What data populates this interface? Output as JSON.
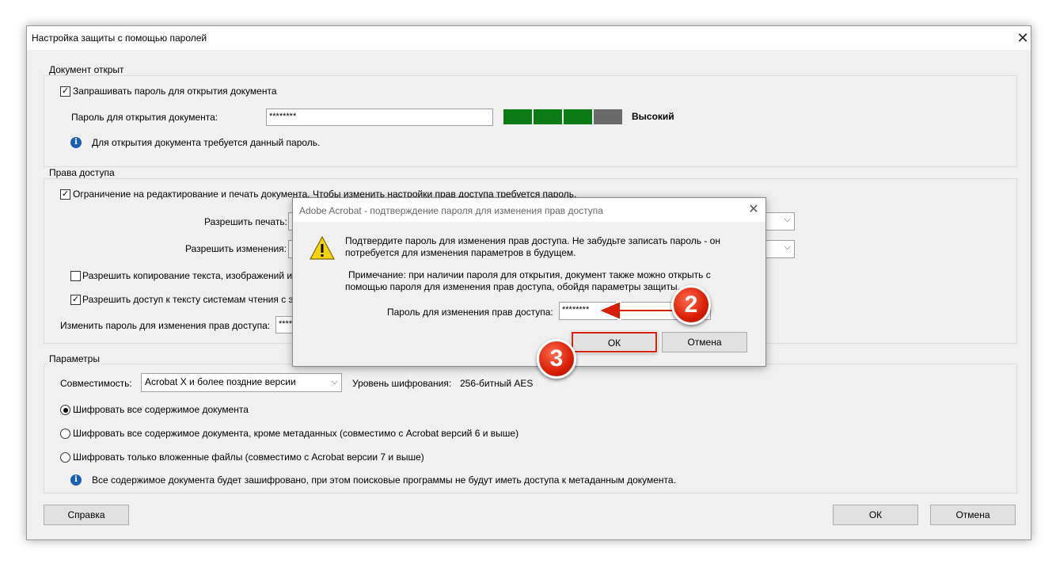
{
  "window": {
    "title": "Настройка защиты с помощью паролей"
  },
  "open_section": {
    "title": "Документ открыт",
    "require_label": "Запрашивать пароль для открытия документа",
    "require_checked": true,
    "password_label": "Пароль для открытия документа:",
    "password_value": "********",
    "strength_label": "Высокий",
    "strength_fraction": 0.75,
    "strength_colors": [
      "#0c7a14",
      "#0c7a14",
      "#0c7a14",
      "#6a6a6a"
    ],
    "info": "Для открытия документа требуется данный пароль."
  },
  "permissions_section": {
    "title": "Права доступа",
    "restrict_label": "Ограничение на редактирование и печать документа. Чтобы изменить настройки прав доступа требуется пароль.",
    "restrict_checked": true,
    "allow_print_label": "Разрешить печать:",
    "allow_changes_label": "Разрешить изменения:",
    "copy_label": "Разрешить копирование текста, изображений и",
    "copy_checked": false,
    "screenreader_label": "Разрешить доступ к тексту системам чтения с эк",
    "screenreader_checked": true,
    "change_pw_label": "Изменить пароль для изменения прав доступа:",
    "change_pw_value": "****"
  },
  "params_section": {
    "title": "Параметры",
    "compat_label": "Совместимость:",
    "compat_value": "Acrobat X и более поздние версии",
    "encryption_label": "Уровень шифрования:",
    "encryption_value": "256-битный AES",
    "radios": [
      {
        "label": "Шифровать все содержимое документа",
        "checked": true
      },
      {
        "label": "Шифровать все содержимое документа, кроме метаданных (совместимо с Acrobat версий 6 и выше)",
        "checked": false
      },
      {
        "label": "Шифровать только вложенные файлы (совместимо с Acrobat версии 7 и выше)",
        "checked": false
      }
    ],
    "info": "Все содержимое документа будет зашифровано, при этом поисковые программы не будут иметь доступа к метаданным документа."
  },
  "footer": {
    "help_label": "Справка",
    "ok_label": "ОК",
    "cancel_label": "Отмена"
  },
  "confirm_dialog": {
    "title": "Adobe Acrobat - подтверждение пароля для изменения прав доступа",
    "message": "Подтвердите пароль для изменения прав доступа. Не забудьте записать пароль - он потребуется для изменения параметров в будущем.",
    "note": "Примечание: при наличии пароля для открытия, документ также можно открыть с помощью пароля для изменения прав доступа, обойдя параметры защиты.",
    "password_label": "Пароль для изменения прав доступа:",
    "password_value": "********",
    "ok_label": "ОК",
    "cancel_label": "Отмена"
  },
  "callouts": {
    "step2": "2",
    "step3": "3",
    "color": "#d81e05"
  },
  "icons": {
    "close": "close-icon",
    "info": "info-icon",
    "warning": "warning-icon",
    "dropdown": "chevron-down-icon",
    "arrow": "arrow-left-icon"
  }
}
